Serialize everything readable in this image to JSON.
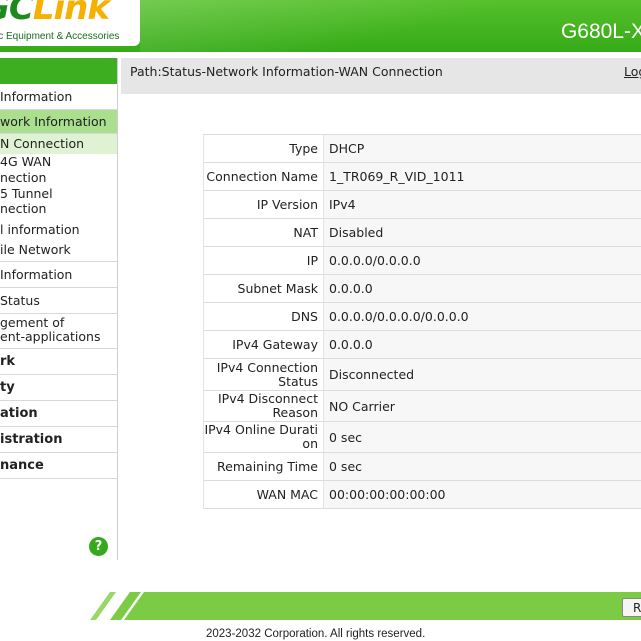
{
  "header": {
    "brand_part1": "GC",
    "brand_part2": "Link",
    "brand_tagline": "ic Equipment & Accessories",
    "model": "G680L-X"
  },
  "sidebar": {
    "items": [
      {
        "label": "Information"
      },
      {
        "label": "work Information"
      },
      {
        "label": "N Connection"
      },
      {
        "label": "4G WAN"
      },
      {
        "label": "nection"
      },
      {
        "label": "5 Tunnel"
      },
      {
        "label": "nection"
      },
      {
        "label": "l information"
      },
      {
        "label": "ile Network"
      },
      {
        "label": "Information"
      },
      {
        "label": "Status"
      },
      {
        "label": "gement of"
      },
      {
        "label": "ent-applications"
      },
      {
        "label": "rk"
      },
      {
        "label": "ty"
      },
      {
        "label": "ation"
      },
      {
        "label": "istration"
      },
      {
        "label": "nance"
      }
    ],
    "help_label": "?"
  },
  "pathbar": {
    "path": "Path:Status-Network Information-WAN Connection",
    "logout": "Log"
  },
  "wan_info": {
    "rows": [
      {
        "key": "Type",
        "value": "DHCP"
      },
      {
        "key": "Connection Name",
        "value": "1_TR069_R_VID_1011"
      },
      {
        "key": "IP Version",
        "value": "IPv4"
      },
      {
        "key": "NAT",
        "value": "Disabled"
      },
      {
        "key": "IP",
        "value": "0.0.0.0/0.0.0.0"
      },
      {
        "key": "Subnet Mask",
        "value": "0.0.0.0"
      },
      {
        "key": "DNS",
        "value": "0.0.0.0/0.0.0.0/0.0.0.0"
      },
      {
        "key": "IPv4 Gateway",
        "value": "0.0.0.0"
      },
      {
        "key": "IPv4 Connection Status",
        "value": "Disconnected"
      },
      {
        "key": "IPv4 Disconnect Reason",
        "value": "NO Carrier"
      },
      {
        "key": "IPv4 Online Duration",
        "value": "0 sec"
      },
      {
        "key": "Remaining Time",
        "value": "0 sec"
      },
      {
        "key": "WAN MAC",
        "value": "00:00:00:00:00:00"
      }
    ]
  },
  "footer": {
    "refresh": "R",
    "copyright": "2023-2032 Corporation. All rights reserved."
  },
  "colors": {
    "brand_green": "#3cb21c",
    "active_menu": "#a9df8e",
    "footer_green": "#7ccb45"
  }
}
